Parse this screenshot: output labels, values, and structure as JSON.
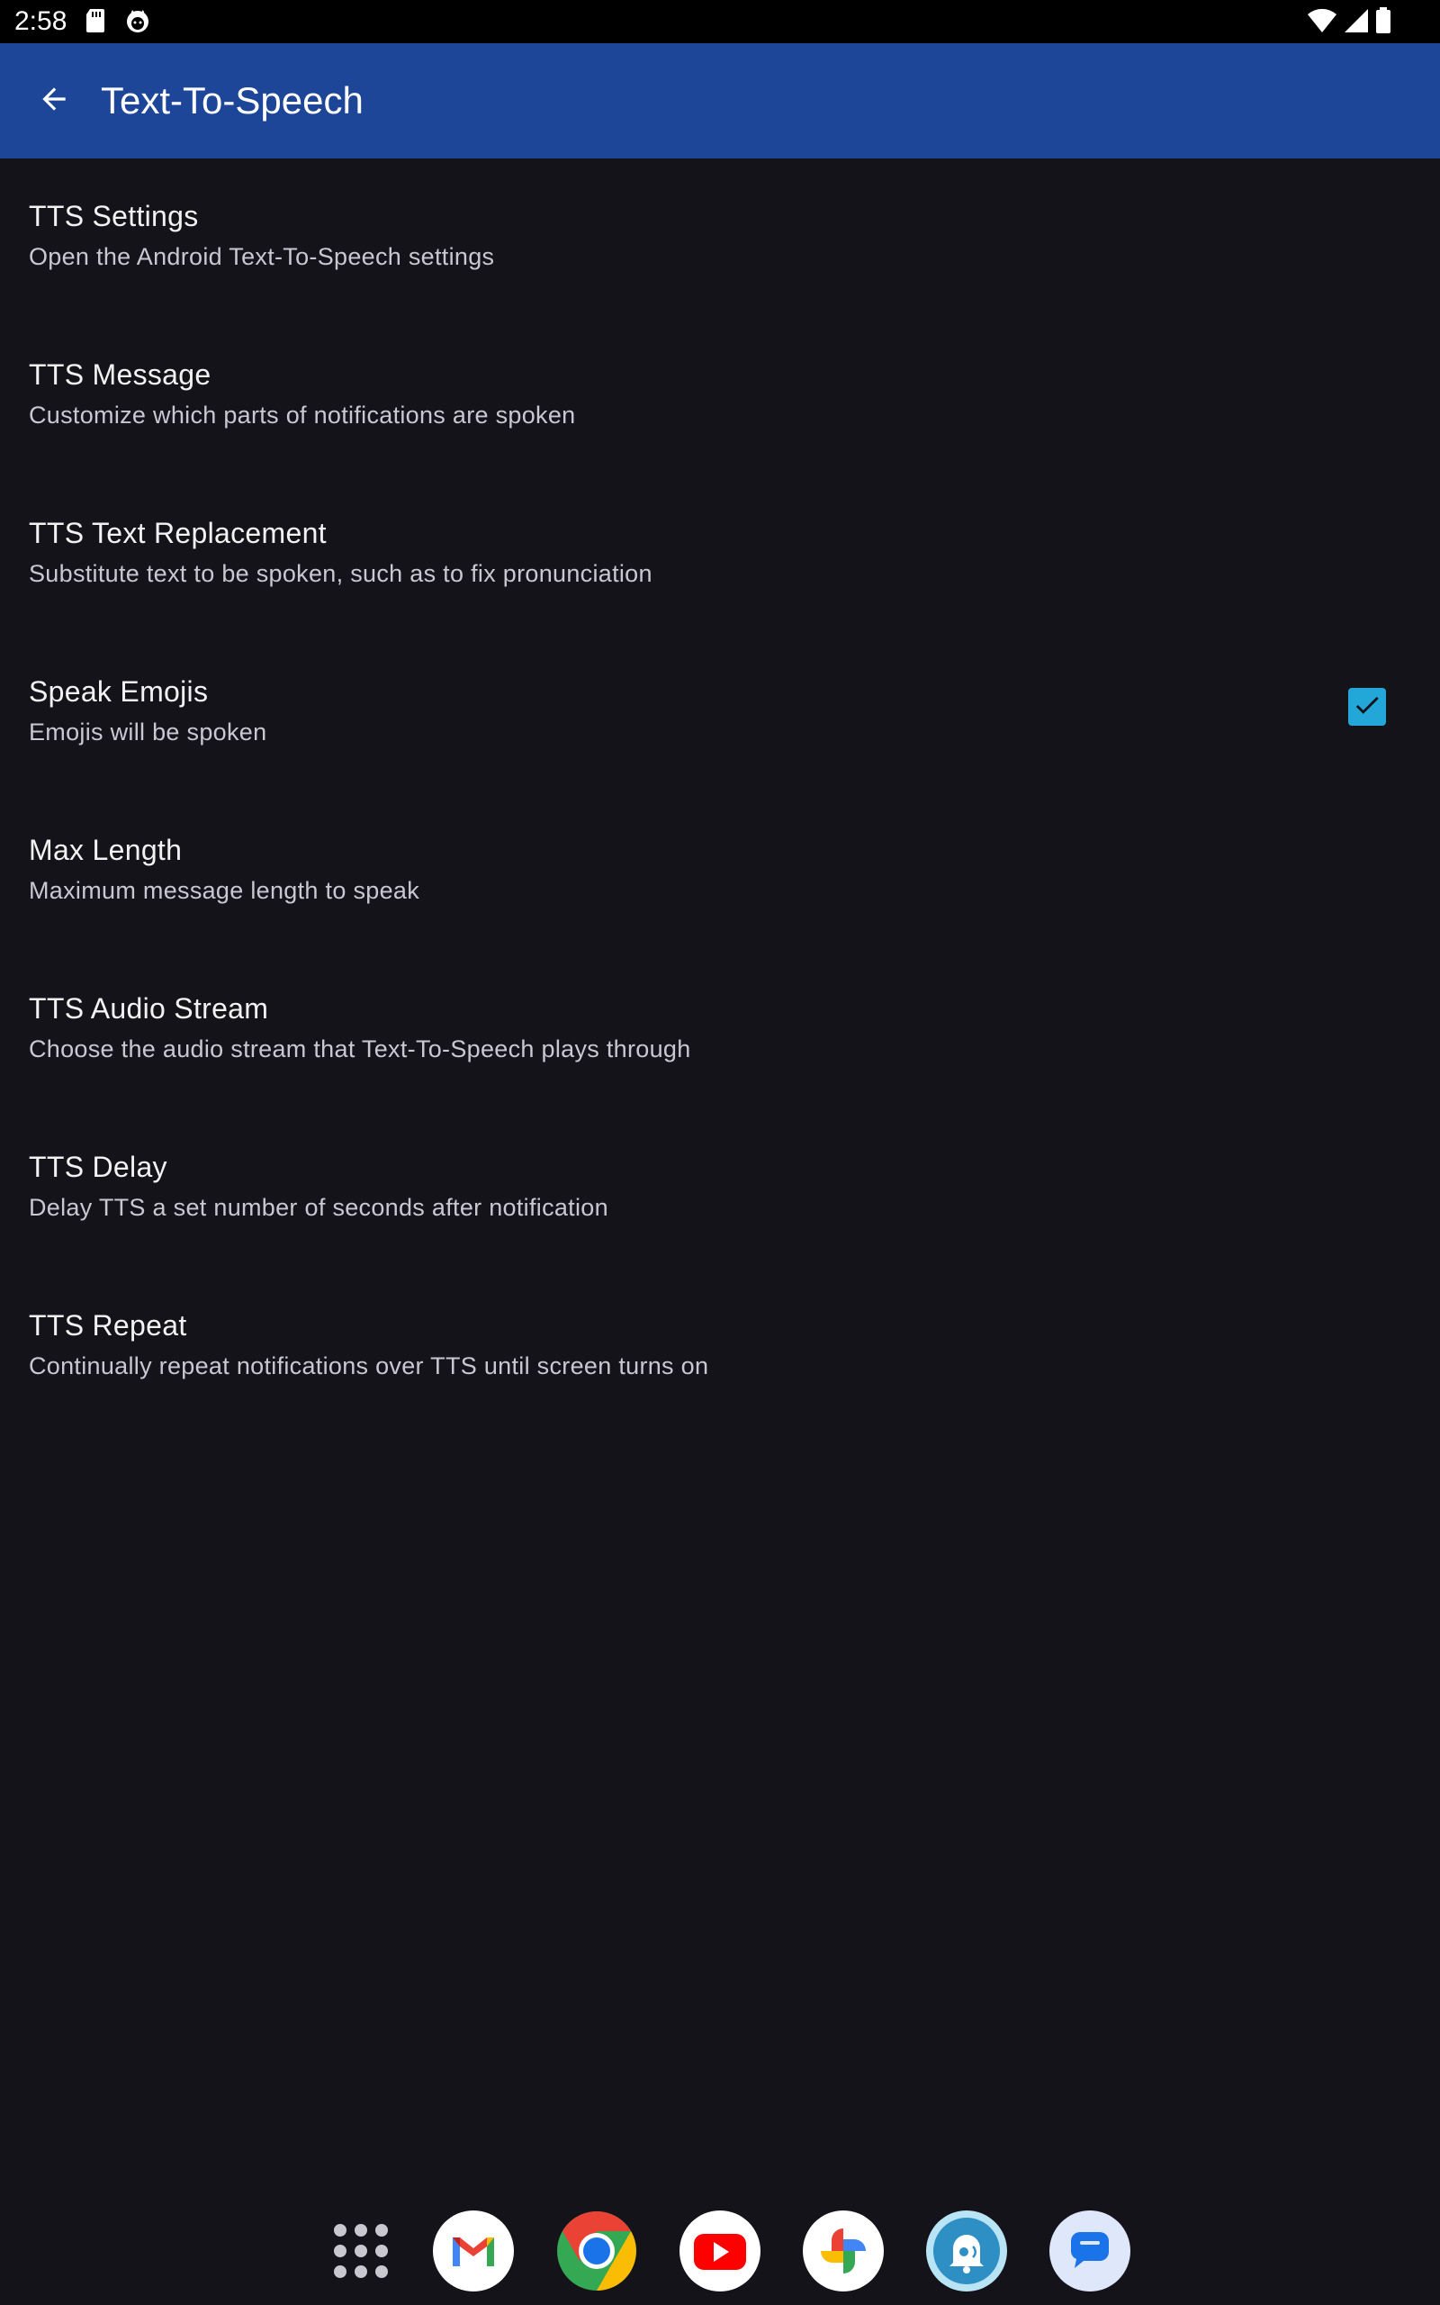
{
  "status_bar": {
    "time": "2:58",
    "icons": [
      "sd-card-icon",
      "cat-notification-icon",
      "wifi-icon",
      "signal-icon",
      "battery-icon"
    ]
  },
  "app_bar": {
    "title": "Text-To-Speech",
    "back_icon": "arrow-back-icon",
    "color": "#1e4698"
  },
  "preferences": [
    {
      "title": "TTS Settings",
      "summary": "Open the Android Text-To-Speech settings"
    },
    {
      "title": "TTS Message",
      "summary": "Customize which parts of notifications are spoken"
    },
    {
      "title": "TTS Text Replacement",
      "summary": "Substitute text to be spoken, such as to fix pronunciation"
    },
    {
      "title": "Speak Emojis",
      "summary": "Emojis will be spoken",
      "checked": true
    },
    {
      "title": "Max Length",
      "summary": "Maximum message length to speak"
    },
    {
      "title": "TTS Audio Stream",
      "summary": "Choose the audio stream that Text-To-Speech plays through"
    },
    {
      "title": "TTS Delay",
      "summary": "Delay TTS a set number of seconds after notification"
    },
    {
      "title": "TTS Repeat",
      "summary": "Continually repeat notifications over TTS until screen turns on"
    }
  ],
  "colors": {
    "background": "#14131a",
    "accent": "#22a7d8"
  },
  "dock": {
    "apps": [
      "app-drawer-icon",
      "gmail-icon",
      "chrome-icon",
      "youtube-icon",
      "photos-icon",
      "notification-reader-icon",
      "messages-icon"
    ]
  }
}
